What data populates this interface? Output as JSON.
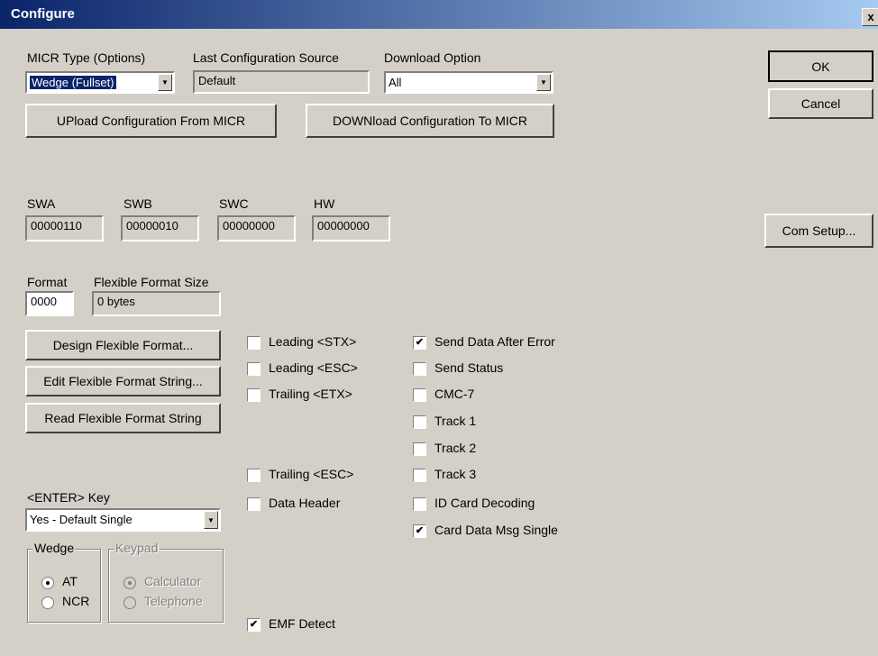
{
  "window": {
    "title": "Configure",
    "close_label": "x"
  },
  "micr_type": {
    "label": "MICR Type (Options)",
    "value": "Wedge (Fullset)"
  },
  "last_source": {
    "label": "Last Configuration Source",
    "value": "Default"
  },
  "download_option": {
    "label": "Download Option",
    "value": "All"
  },
  "buttons": {
    "upload": "UPload Configuration From MICR",
    "download": "DOWNload Configuration To MICR",
    "ok": "OK",
    "cancel": "Cancel",
    "com_setup": "Com Setup...",
    "design_ff": "Design Flexible Format...",
    "edit_ff": "Edit Flexible Format String...",
    "read_ff": "Read Flexible Format String"
  },
  "switches": {
    "swa": {
      "label": "SWA",
      "value": "00000110"
    },
    "swb": {
      "label": "SWB",
      "value": "00000010"
    },
    "swc": {
      "label": "SWC",
      "value": "00000000"
    },
    "hw": {
      "label": "HW",
      "value": "00000000"
    }
  },
  "format": {
    "label": "Format",
    "value": "0000"
  },
  "ff_size": {
    "label": "Flexible Format Size",
    "value": "0 bytes"
  },
  "checkboxes_left": [
    {
      "label": "Leading <STX>",
      "checked": false
    },
    {
      "label": "Leading <ESC>",
      "checked": false
    },
    {
      "label": "Trailing <ETX>",
      "checked": false
    },
    {
      "label": "Trailing <ESC>",
      "checked": false
    },
    {
      "label": "Data Header",
      "checked": false
    },
    {
      "label": "EMF Detect",
      "checked": true
    }
  ],
  "checkboxes_right": [
    {
      "label": "Send Data After Error",
      "checked": true
    },
    {
      "label": "Send Status",
      "checked": false
    },
    {
      "label": "CMC-7",
      "checked": false
    },
    {
      "label": "Track 1",
      "checked": false
    },
    {
      "label": "Track 2",
      "checked": false
    },
    {
      "label": "Track 3",
      "checked": false
    },
    {
      "label": "ID Card Decoding",
      "checked": false
    },
    {
      "label": "Card Data Msg Single",
      "checked": true
    }
  ],
  "enter_key": {
    "label": "<ENTER> Key",
    "value": "Yes - Default Single"
  },
  "wedge": {
    "title": "Wedge",
    "options": [
      {
        "label": "AT",
        "selected": true
      },
      {
        "label": "NCR",
        "selected": false
      }
    ]
  },
  "keypad": {
    "title": "Keypad",
    "options": [
      {
        "label": "Calculator",
        "selected": true
      },
      {
        "label": "Telephone",
        "selected": false
      }
    ]
  }
}
